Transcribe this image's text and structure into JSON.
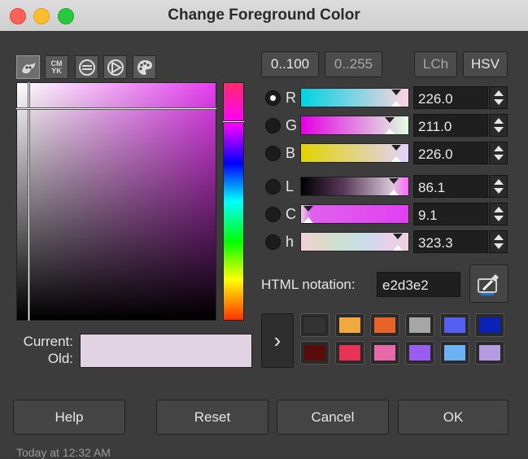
{
  "window": {
    "title": "Change Foreground Color"
  },
  "selectors": [
    {
      "name": "gimp-wilber-icon"
    },
    {
      "name": "cmyk-icon",
      "text": "CM YK"
    },
    {
      "name": "watercolor-icon"
    },
    {
      "name": "triangle-wheel-icon"
    },
    {
      "name": "palette-icon"
    }
  ],
  "range_buttons": {
    "r100": "0..100",
    "r255": "0..255"
  },
  "mode_buttons": {
    "lch": "LCh",
    "hsv": "HSV"
  },
  "channels": [
    {
      "label": "R",
      "value": "226.0",
      "checked": true,
      "fraction": 0.886,
      "gradient": "linear-gradient(to right,#00d3e2,#ffd3e2)"
    },
    {
      "label": "G",
      "value": "211.0",
      "checked": false,
      "fraction": 0.827,
      "gradient": "linear-gradient(to right,#e200e2,#e2ffe2)"
    },
    {
      "label": "B",
      "value": "226.0",
      "checked": false,
      "fraction": 0.886,
      "gradient": "linear-gradient(to right,#e2d300,#e2d3ff)"
    },
    {
      "label": "L",
      "value": "86.1",
      "checked": false,
      "fraction": 0.861,
      "gradient": "linear-gradient(to right,#000000,#5a3a5a 40%,#d8c8d8 85%,#ff66ff)"
    },
    {
      "label": "C",
      "value": "9.1",
      "checked": false,
      "fraction": 0.07,
      "gradient": "linear-gradient(to right,#e2d3e2 0%,#e060ee 10%,#e040f0)"
    },
    {
      "label": "h",
      "value": "323.3",
      "checked": false,
      "fraction": 0.898,
      "gradient": "linear-gradient(to right,#f0d0d8,#e0d8c8,#d0e0d0,#c8e0e0,#d0d8f0,#e8d0e8,#f0d0e0)"
    }
  ],
  "html_notation": {
    "label": "HTML notation:",
    "value": "e2d3e2"
  },
  "current_label": "Current:",
  "old_label": "Old:",
  "colors": {
    "current": "#e2d3e2"
  },
  "history": [
    "#333333",
    "#f2a93b",
    "#e8632a",
    "#a6a6a6",
    "#5560f0",
    "#0b22b8",
    "#5a0c0c",
    "#e93355",
    "#e66aa8",
    "#9a5df2",
    "#6cb3f6",
    "#b69be0"
  ],
  "history_arrow": "›",
  "buttons": {
    "help": "Help",
    "reset": "Reset",
    "cancel": "Cancel",
    "ok": "OK"
  },
  "footer_text": "Today at 12:32 AM"
}
